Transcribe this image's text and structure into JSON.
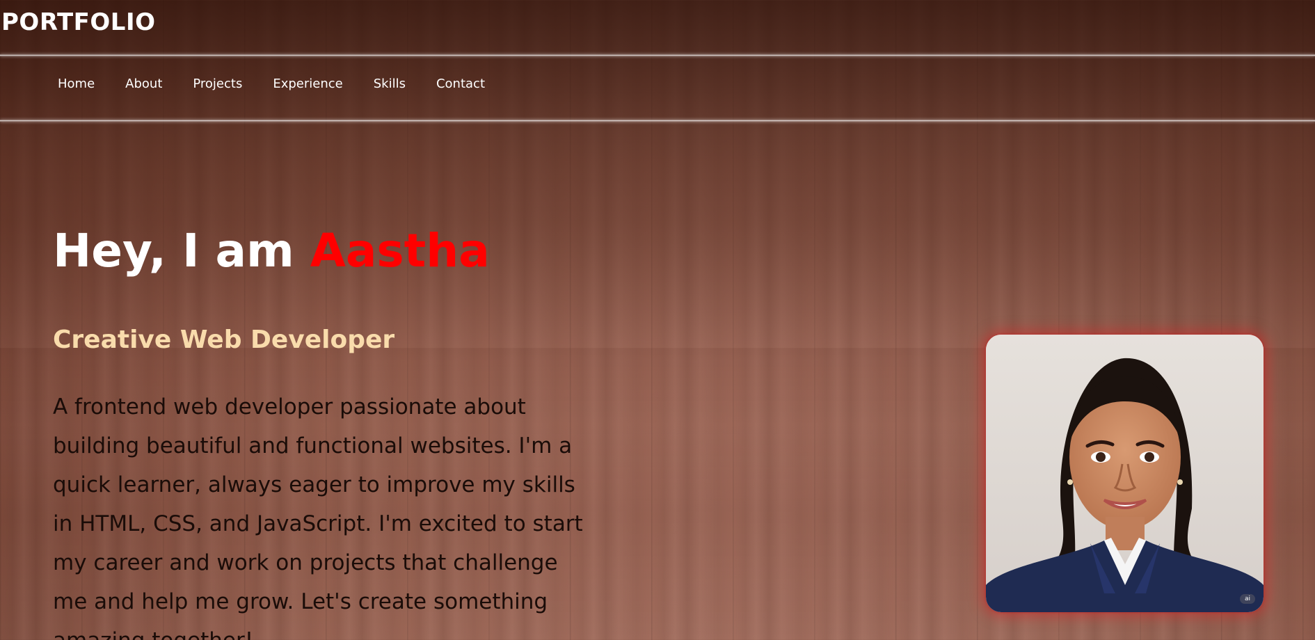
{
  "header": {
    "logo": "PORTFOLIO",
    "nav": [
      {
        "label": "Home"
      },
      {
        "label": "About"
      },
      {
        "label": "Projects"
      },
      {
        "label": "Experience"
      },
      {
        "label": "Skills"
      },
      {
        "label": "Contact"
      }
    ]
  },
  "hero": {
    "greeting": "Hey, I am ",
    "name": "Aastha",
    "subtitle": "Creative Web Developer",
    "description": "A frontend web developer passionate about building beautiful and functional websites. I'm a quick learner, always eager to improve my skills in HTML, CSS, and JavaScript. I'm excited to start my career and work on projects that challenge me and help me grow. Let's create something amazing together!",
    "photo": {
      "badge": "ai"
    }
  },
  "colors": {
    "name_accent": "#ff0000",
    "subtitle": "#f9dcac",
    "photo_glow": "#d22828"
  }
}
